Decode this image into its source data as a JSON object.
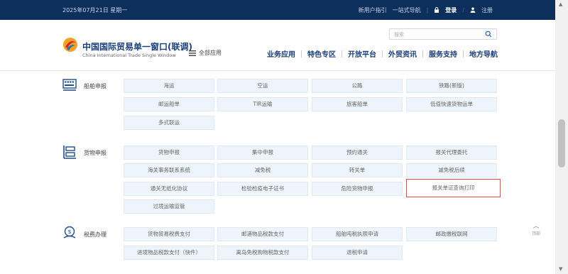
{
  "topbar": {
    "date": "2025年07月21日 星期一",
    "links": [
      "新用户指引",
      "一站式导航"
    ],
    "login": "登录",
    "register": "注册"
  },
  "header": {
    "title_cn": "中国国际贸易单一窗口(联调)",
    "title_en": "China International Trade Single Window",
    "all_apps": "全部应用",
    "search_placeholder": "搜索",
    "nav": [
      "业务应用",
      "特色专区",
      "开放平台",
      "外贸资讯",
      "服务支持",
      "地方导航"
    ]
  },
  "sections": [
    {
      "label": "船舶申报",
      "icon": "ship-declaration-icon",
      "items": [
        "海运",
        "空运",
        "公路",
        "铁路(新版)",
        "邮运船单",
        "TIR运输",
        "旅客船单",
        "低值快速货物运单",
        "多式联运"
      ]
    },
    {
      "label": "货物申报",
      "icon": "cargo-declaration-icon",
      "items": [
        "货物申报",
        "集中申报",
        "预约通关",
        "报关代理委托",
        "海关事务联系系统",
        "减免税",
        "转关单",
        "减免税后续",
        "通关无纸化协议",
        "检验检疫电子证书",
        "危险货物申报",
        "报关单证查询打印",
        "过境运输监管"
      ]
    },
    {
      "label": "税费办理",
      "icon": "tax-payment-icon",
      "items": [
        "货物贸易税费支付",
        "邮递物品税款支付",
        "船舶吨税执照申请",
        "邮政缴税联网",
        "进境物品税款支付（快件）",
        "离岛免税购物税款支付",
        "退税申请"
      ]
    }
  ],
  "highlight_item": "报关单证查询打印",
  "back_to_top": "顶部"
}
